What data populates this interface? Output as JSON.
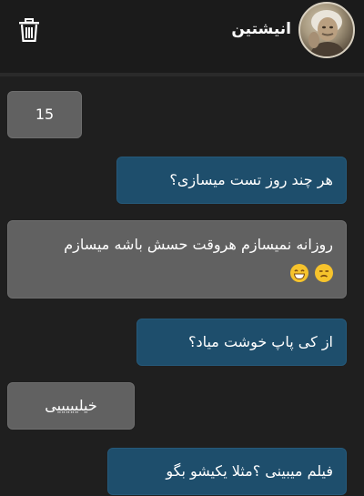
{
  "header": {
    "contact_name": "انیشتین",
    "trash_icon": "trash-icon",
    "avatar_icon": "avatar"
  },
  "messages": [
    {
      "direction": "incoming",
      "text": "15"
    },
    {
      "direction": "outgoing",
      "text": "هر چند روز تست میسازی؟"
    },
    {
      "direction": "incoming",
      "text": "روزانه نمیسازم هروقت حسش باشه میسازم",
      "emojis": [
        "unamused-face-icon",
        "grinning-face-icon"
      ]
    },
    {
      "direction": "outgoing",
      "text": "از کی پاپ خوشت میاد؟"
    },
    {
      "direction": "incoming",
      "text": "خیلیییییی"
    },
    {
      "direction": "outgoing",
      "text": "فیلم میبینی ؟مثلا یکیشو بگو"
    }
  ],
  "colors": {
    "background": "#1f1f1f",
    "incoming_bubble": "#616161",
    "outgoing_bubble": "#1e4e6c",
    "text": "#ffffff"
  }
}
